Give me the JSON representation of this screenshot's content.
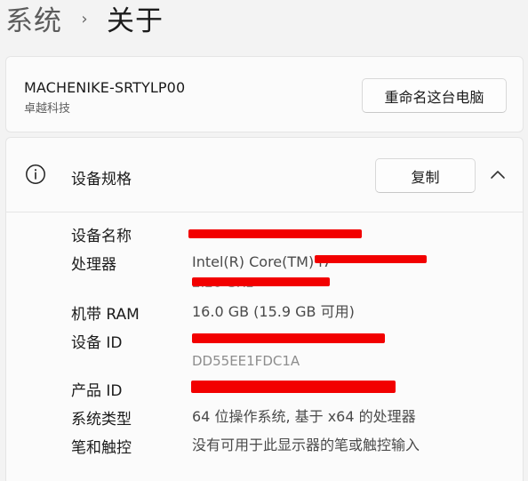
{
  "breadcrumb": {
    "parent": "系统",
    "separator": "›",
    "current": "关于"
  },
  "device": {
    "name": "MACHENIKE-SRTYLP00",
    "model": "卓越科技",
    "rename_button": "重命名这台电脑"
  },
  "specs": {
    "title": "设备规格",
    "copy_button": "复制",
    "rows": [
      {
        "label": "设备名称",
        "value": ""
      },
      {
        "label": "处理器",
        "value": "Intel(R) Core(TM) i7",
        "value_line2": "2.20 GHz"
      },
      {
        "label": "机带 RAM",
        "value": "16.0 GB (15.9 GB 可用)"
      },
      {
        "label": "设备 ID",
        "value": "",
        "value_line2": "DD55EE1FDC1A"
      },
      {
        "label": "产品 ID",
        "value": ""
      },
      {
        "label": "系统类型",
        "value": "64 位操作系统, 基于 x64 的处理器"
      },
      {
        "label": "笔和触控",
        "value": "没有可用于此显示器的笔或触控输入"
      }
    ]
  },
  "colors": {
    "redaction": "#f20000",
    "background": "#f3f3f3",
    "card": "#fbfbfb"
  },
  "icons": {
    "breadcrumb_separator": "chevron-right-icon",
    "specs_header": "info-icon",
    "collapse": "chevron-up-icon"
  }
}
